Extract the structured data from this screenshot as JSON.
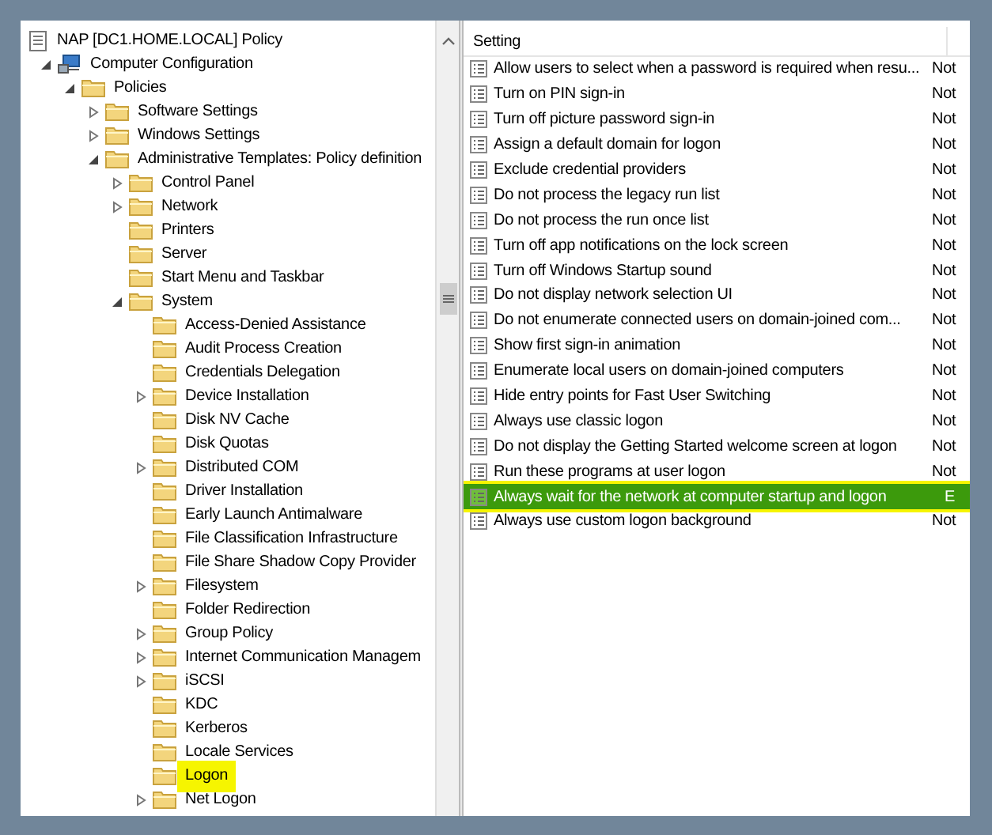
{
  "tree": [
    {
      "label": "NAP [DC1.HOME.LOCAL] Policy",
      "kind": "policy",
      "children": [
        {
          "label": "Computer Configuration",
          "kind": "computer",
          "expanded": true,
          "children": [
            {
              "label": "Policies",
              "kind": "folder",
              "expanded": true,
              "children": [
                {
                  "label": "Software Settings",
                  "kind": "folder",
                  "expanded": false
                },
                {
                  "label": "Windows Settings",
                  "kind": "folder",
                  "expanded": false
                },
                {
                  "label": "Administrative Templates: Policy definition",
                  "kind": "folder",
                  "expanded": true,
                  "children": [
                    {
                      "label": "Control Panel",
                      "kind": "folder",
                      "expanded": false
                    },
                    {
                      "label": "Network",
                      "kind": "folder",
                      "expanded": false
                    },
                    {
                      "label": "Printers",
                      "kind": "folder"
                    },
                    {
                      "label": "Server",
                      "kind": "folder"
                    },
                    {
                      "label": "Start Menu and Taskbar",
                      "kind": "folder"
                    },
                    {
                      "label": "System",
                      "kind": "folder",
                      "expanded": true,
                      "children": [
                        {
                          "label": "Access-Denied Assistance",
                          "kind": "folder"
                        },
                        {
                          "label": "Audit Process Creation",
                          "kind": "folder"
                        },
                        {
                          "label": "Credentials Delegation",
                          "kind": "folder"
                        },
                        {
                          "label": "Device Installation",
                          "kind": "folder",
                          "expanded": false
                        },
                        {
                          "label": "Disk NV Cache",
                          "kind": "folder"
                        },
                        {
                          "label": "Disk Quotas",
                          "kind": "folder"
                        },
                        {
                          "label": "Distributed COM",
                          "kind": "folder",
                          "expanded": false
                        },
                        {
                          "label": "Driver Installation",
                          "kind": "folder"
                        },
                        {
                          "label": "Early Launch Antimalware",
                          "kind": "folder"
                        },
                        {
                          "label": "File Classification Infrastructure",
                          "kind": "folder"
                        },
                        {
                          "label": "File Share Shadow Copy Provider",
                          "kind": "folder"
                        },
                        {
                          "label": "Filesystem",
                          "kind": "folder",
                          "expanded": false
                        },
                        {
                          "label": "Folder Redirection",
                          "kind": "folder"
                        },
                        {
                          "label": "Group Policy",
                          "kind": "folder",
                          "expanded": false
                        },
                        {
                          "label": "Internet Communication Managem",
                          "kind": "folder",
                          "expanded": false
                        },
                        {
                          "label": "iSCSI",
                          "kind": "folder",
                          "expanded": false
                        },
                        {
                          "label": "KDC",
                          "kind": "folder"
                        },
                        {
                          "label": "Kerberos",
                          "kind": "folder"
                        },
                        {
                          "label": "Locale Services",
                          "kind": "folder"
                        },
                        {
                          "label": "Logon",
                          "kind": "folder",
                          "highlighted": true
                        },
                        {
                          "label": "Net Logon",
                          "kind": "folder",
                          "expanded": false
                        }
                      ]
                    }
                  ]
                }
              ]
            }
          ]
        }
      ]
    }
  ],
  "settings": {
    "columns": [
      "Setting"
    ],
    "rows": [
      {
        "name": "Allow users to select when a password is required when resu...",
        "state": "Not",
        "selected": false
      },
      {
        "name": "Turn on PIN sign-in",
        "state": "Not",
        "selected": false
      },
      {
        "name": "Turn off picture password sign-in",
        "state": "Not",
        "selected": false
      },
      {
        "name": "Assign a default domain for logon",
        "state": "Not",
        "selected": false
      },
      {
        "name": "Exclude credential providers",
        "state": "Not",
        "selected": false
      },
      {
        "name": "Do not process the legacy run list",
        "state": "Not",
        "selected": false
      },
      {
        "name": "Do not process the run once list",
        "state": "Not",
        "selected": false
      },
      {
        "name": "Turn off app notifications on the lock screen",
        "state": "Not",
        "selected": false
      },
      {
        "name": "Turn off Windows Startup sound",
        "state": "Not",
        "selected": false
      },
      {
        "name": "Do not display network selection UI",
        "state": "Not",
        "selected": false
      },
      {
        "name": "Do not enumerate connected users on domain-joined com...",
        "state": "Not",
        "selected": false
      },
      {
        "name": "Show first sign-in animation",
        "state": "Not",
        "selected": false
      },
      {
        "name": "Enumerate local users on domain-joined computers",
        "state": "Not",
        "selected": false
      },
      {
        "name": "Hide entry points for Fast User Switching",
        "state": "Not",
        "selected": false
      },
      {
        "name": "Always use classic logon",
        "state": "Not",
        "selected": false
      },
      {
        "name": "Do not display the Getting Started welcome screen at logon",
        "state": "Not",
        "selected": false
      },
      {
        "name": "Run these programs at user logon",
        "state": "Not",
        "selected": false
      },
      {
        "name": "Always wait for the network at computer startup and logon",
        "state": "E",
        "selected": true
      },
      {
        "name": "Always use custom logon background",
        "state": "Not",
        "selected": false
      }
    ]
  }
}
